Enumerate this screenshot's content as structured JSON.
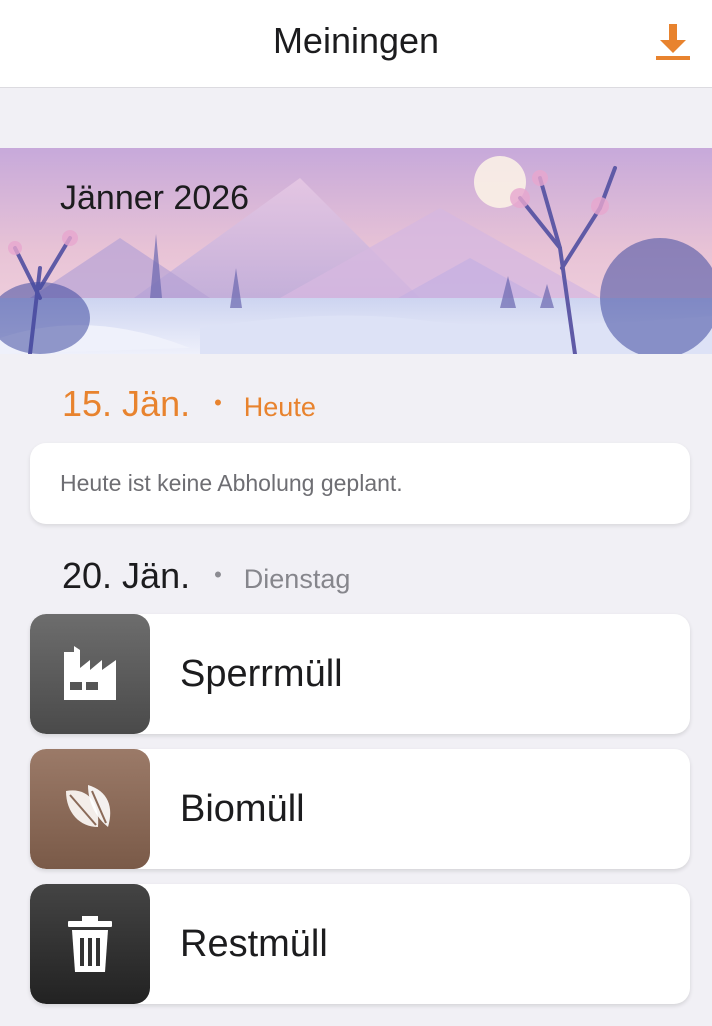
{
  "header": {
    "title": "Meiningen",
    "download_icon": "download-icon",
    "accent_color": "#e8832e"
  },
  "banner": {
    "month_title": "Jänner 2026"
  },
  "days": [
    {
      "date": "15. Jän.",
      "dot": "•",
      "label": "Heute",
      "note": "Heute ist keine Abholung geplant."
    },
    {
      "date": "20. Jän.",
      "dot": "•",
      "label": "Dienstag",
      "pickups": [
        {
          "name": "Sperrmüll",
          "icon": "factory-icon",
          "color": "#5d5d5d"
        },
        {
          "name": "Biomüll",
          "icon": "leaf-icon",
          "color": "#8a6a58"
        },
        {
          "name": "Restmüll",
          "icon": "trash-icon",
          "color": "#333333"
        }
      ]
    }
  ]
}
